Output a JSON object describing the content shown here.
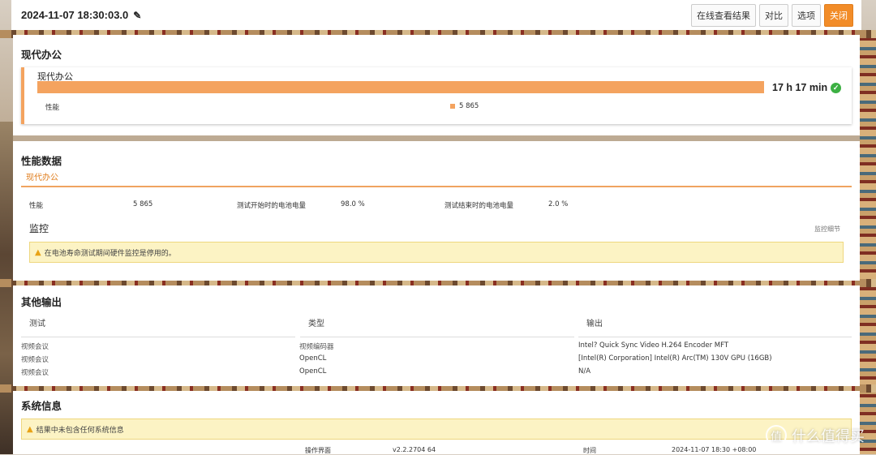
{
  "header": {
    "title": "2024-11-07 18:30:03.0",
    "buttons": {
      "online": "在线查看结果",
      "compare": "对比",
      "options": "选项",
      "close": "关闭"
    }
  },
  "summary": {
    "heading": "现代办公",
    "run_name": "现代办公",
    "result": "17 h 17 min",
    "perf_label": "性能",
    "legend_value": "5 865"
  },
  "perf": {
    "heading": "性能数据",
    "tab": "现代办公",
    "metrics": {
      "perf_label": "性能",
      "perf_value": "5 865",
      "start_label": "测试开始时的电池电量",
      "start_value": "98.0 %",
      "end_label": "测试结束时的电池电量",
      "end_value": "2.0 %"
    },
    "monitor_title": "监控",
    "monitor_link": "监控细节",
    "alert": "在电池寿命测试期间硬件监控是停用的。"
  },
  "other": {
    "heading": "其他输出",
    "columns": [
      "测试",
      "类型",
      "输出"
    ],
    "rows": [
      [
        "视频会议",
        "视频编码器",
        "Intel? Quick Sync Video H.264 Encoder MFT"
      ],
      [
        "视频会议",
        "OpenCL",
        "[Intel(R) Corporation] Intel(R) Arc(TM) 130V GPU (16GB)"
      ],
      [
        "视频会议",
        "OpenCL",
        "N/A"
      ]
    ]
  },
  "sysinfo": {
    "heading": "系统信息",
    "alert": "结果中未包含任何系统信息",
    "ui_label": "操作界面",
    "ui_value": "v2.2.2704 64",
    "time_label": "时间",
    "time_value": "2024-11-07 18:30 +08:00"
  },
  "watermark": {
    "text": "什么值得买",
    "logo": "值"
  },
  "colors": {
    "accent": "#f28c28",
    "bar": "#f4a35f",
    "success": "#3cb043",
    "alert_bg": "#fcf3c4"
  }
}
